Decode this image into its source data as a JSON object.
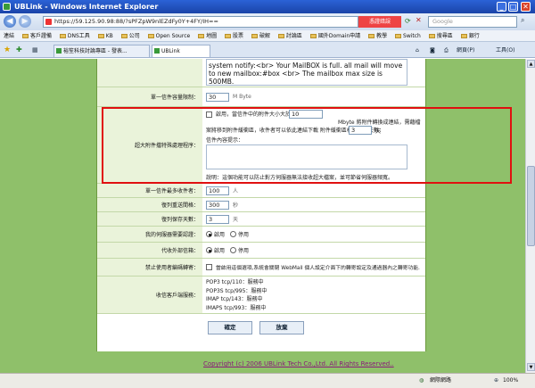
{
  "window": {
    "title": "UBLink - Windows Internet Explorer",
    "min": "_",
    "max": "□",
    "close": "✕"
  },
  "address": {
    "url": "https://59.125.90.98:88/?sPFZpW9nlEZdFy0Y+4FY/IH==",
    "cert_error": "憑證錯誤",
    "search_placeholder": "Google"
  },
  "favorites": {
    "label": "連結",
    "items": [
      "客戶證備",
      "DNS工具",
      "KB",
      "公司",
      "Open Source",
      "地圖",
      "股票",
      "破解",
      "討論區",
      "國外Domain申請",
      "教學",
      "Switch",
      "搜尋區",
      "銀行"
    ]
  },
  "tabs": [
    {
      "label": "裕笙科技討論專區 - 發表..."
    },
    {
      "label": "UBLink"
    }
  ],
  "toolbar": {
    "page": "網頁(P)",
    "tools": "工具(O)"
  },
  "form": {
    "notify_text": "system notify:<br>  Your MailBOX is full. all mail will move to new mailbox:#box <br> The mailbox max size is 500MB.",
    "size_limit": {
      "label": "單一信件容量限制：",
      "value": "30",
      "unit": "M Byte"
    },
    "large_attach": {
      "label": "超大附件擋特殊處理程序：",
      "checkbox_text": "啟用，當信件中的附件大小大於：",
      "size_value": "10",
      "size_text": "Mbyte 將附件轉換成連結，需藉檔案將移到附件緩衝區，收件者可以依此連結下載 附件緩衝區檔案保留天數：",
      "days_value": "3",
      "days_unit": "天",
      "content_label": "信件內容提示：",
      "note": "說明：這個功能可以防止對方伺服器無法接收超大檔案，並可節省伺服器頻寬。"
    },
    "max_recipients": {
      "label": "單一信件最多收件者：",
      "value": "100",
      "unit": "人"
    },
    "retry_interval": {
      "label": "復列重送間格：",
      "value": "300",
      "unit": "秒"
    },
    "retry_days": {
      "label": "復列保存天數：",
      "value": "3",
      "unit": "天"
    },
    "auth": {
      "label": "我的伺服器需要認證：",
      "on": "啟用",
      "off": "停用"
    },
    "proxy": {
      "label": "代收外部信箱：",
      "on": "啟用",
      "off": "停用"
    },
    "webmail": {
      "label": "禁止使用者編碼轉寄：",
      "text": "當啟用這個選項,系統會關閉 WebMail 個人設定介面下的轉寄設定及通過器內之轉寄功能."
    },
    "services": {
      "label": "收信客戶端服務：",
      "items": [
        "POP3 tcp/110：服務中",
        "POP3S tcp/995：服務中",
        "IMAP tcp/143：服務中",
        "IMAPS tcp/993：服務中"
      ]
    },
    "ok": "確定",
    "cancel": "放棄"
  },
  "copyright": "Copyright (c) 2006 UBLink Tech Co.,Ltd. All Rights Reserved..",
  "status": {
    "zone": "網際網路",
    "zoom": "100%"
  }
}
